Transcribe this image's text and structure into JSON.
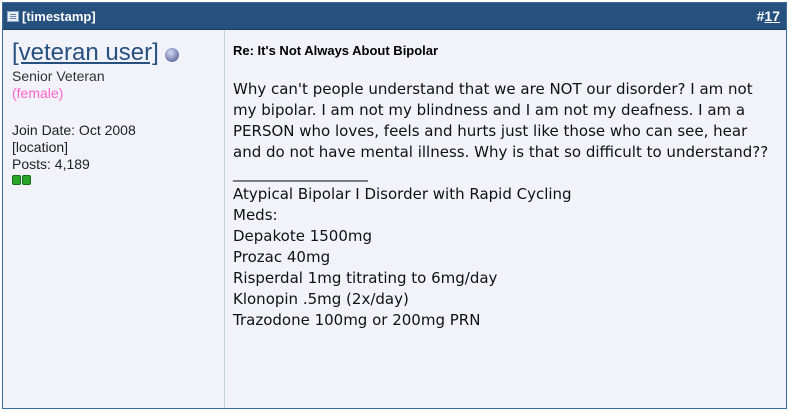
{
  "post": {
    "timestamp": "[timestamp]",
    "number_prefix": "#",
    "number": "17"
  },
  "user": {
    "name": "[veteran user]",
    "title": "Senior Veteran",
    "gender": "(female)",
    "join_date": "Join Date: Oct 2008",
    "location": "[location]",
    "posts": "Posts: 4,189",
    "reputation_pips": 2
  },
  "message": {
    "title": "Re: It's Not Always About Bipolar",
    "body": "Why can't people understand that we are NOT our disorder? I am not my bipolar. I am not my blindness and I am not my deafness. I am a PERSON who loves, feels and hurts just like those who can see, hear and do not have mental illness. Why is that so difficult to understand??",
    "signature_separator": "__________________",
    "signature": [
      "Atypical Bipolar I Disorder with Rapid Cycling",
      "Meds:",
      "Depakote 1500mg",
      "Prozac 40mg",
      "Risperdal 1mg titrating to 6mg/day",
      "Klonopin .5mg (2x/day)",
      "Trazodone 100mg or 200mg PRN"
    ]
  },
  "colors": {
    "header_bg": "#26507e",
    "username": "#26507e",
    "gender": "#ff66cc",
    "reputation": "#2aa52a"
  }
}
